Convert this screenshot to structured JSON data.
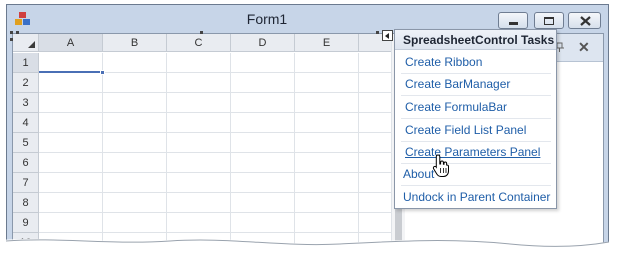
{
  "window": {
    "title": "Form1",
    "icon": "form-app-icon",
    "controls": [
      "minimize-icon",
      "maximize-icon",
      "close-icon"
    ]
  },
  "spreadsheet": {
    "columns": [
      "A",
      "B",
      "C",
      "D",
      "E"
    ],
    "rows": [
      "1",
      "2",
      "3",
      "4",
      "5",
      "6",
      "7",
      "8",
      "9",
      "10"
    ],
    "active_cell": "A1",
    "corner_icon": "select-all-triangle-icon",
    "accent": "#4a6fb5"
  },
  "docked_panel": {
    "icons": [
      "pin-icon",
      "close-icon"
    ]
  },
  "tasks_menu": {
    "title": "SpreadsheetControl Tasks",
    "items": [
      "Create Ribbon",
      "Create BarManager",
      "Create FormulaBar",
      "Create Field List Panel",
      "Create Parameters Panel",
      "About",
      "Undock in Parent Container"
    ],
    "hovered": "Create Parameters Panel",
    "link_color": "#1f5ea8"
  },
  "cursor": "hand-pointer-icon"
}
